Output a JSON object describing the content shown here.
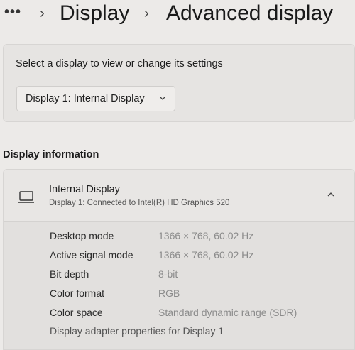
{
  "breadcrumb": {
    "more": "•••",
    "items": [
      "Display",
      "Advanced display"
    ]
  },
  "select_display": {
    "label": "Select a display to view or change its settings",
    "dropdown_value": "Display 1: Internal Display"
  },
  "display_information": {
    "section_title": "Display information",
    "display_name": "Internal Display",
    "display_subtitle": "Display 1: Connected to Intel(R) HD Graphics 520",
    "properties": [
      {
        "label": "Desktop mode",
        "value": "1366 × 768, 60.02 Hz"
      },
      {
        "label": "Active signal mode",
        "value": "1366 × 768, 60.02 Hz"
      },
      {
        "label": "Bit depth",
        "value": "8-bit"
      },
      {
        "label": "Color format",
        "value": "RGB"
      },
      {
        "label": "Color space",
        "value": "Standard dynamic range (SDR)"
      }
    ],
    "adapter_link": "Display adapter properties for Display 1"
  },
  "icons": {
    "more": "more-icon",
    "separator": "chevron-right-icon",
    "dropdown": "chevron-down-icon",
    "monitor": "laptop-icon",
    "collapse": "chevron-up-icon"
  }
}
